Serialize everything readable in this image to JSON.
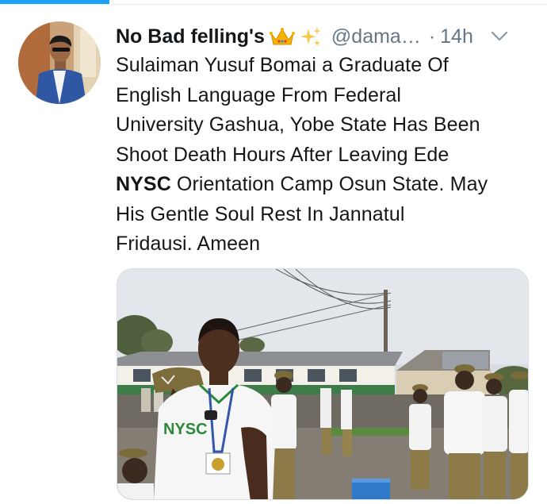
{
  "author": {
    "display_name": "No Bad felling's",
    "emoji_icons": [
      "crown-icon",
      "sparkles-icon"
    ],
    "handle": "@dama…",
    "separator": "·",
    "time": "14h"
  },
  "tweet": {
    "text_lines": [
      {
        "pre": "Sulaiman Yusuf Bomai a Graduate Of",
        "bold": "",
        "post": ""
      },
      {
        "pre": "English Language From Federal",
        "bold": "",
        "post": ""
      },
      {
        "pre": "University Gashua, Yobe State Has Been",
        "bold": "",
        "post": ""
      },
      {
        "pre": "Shoot Death Hours After Leaving Ede",
        "bold": "",
        "post": ""
      },
      {
        "pre": "",
        "bold": "NYSC",
        "post": " Orientation Camp Osun State. May"
      },
      {
        "pre": "His Gentle Soul Rest In Jannatul",
        "bold": "",
        "post": ""
      },
      {
        "pre": "Fridausi. Ameen",
        "bold": "",
        "post": ""
      }
    ]
  },
  "media": {
    "shirt_text": "NYSC"
  },
  "colors": {
    "accent": "#1da1f2",
    "name_text": "#14171a",
    "secondary_text": "#657786",
    "divider": "#e6ecf0",
    "crown": "#f5b400"
  }
}
